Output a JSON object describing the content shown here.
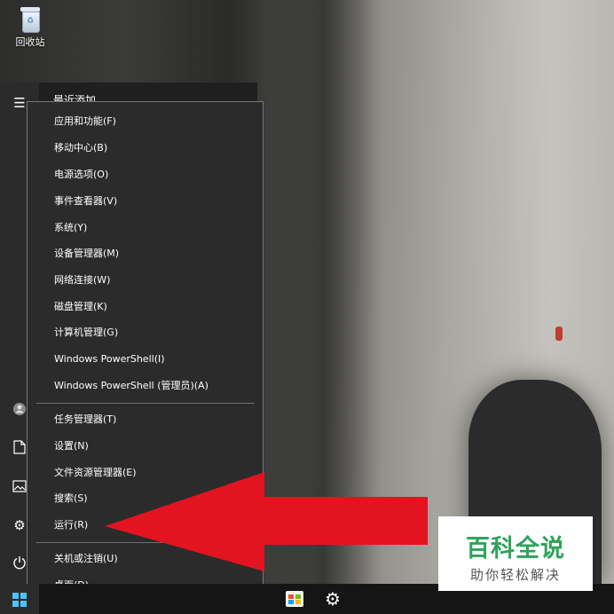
{
  "desktop": {
    "recycle_bin_label": "回收站"
  },
  "start_menu": {
    "recent_label": "最近添加"
  },
  "context_menu": {
    "items": [
      {
        "label": "应用和功能(F)"
      },
      {
        "label": "移动中心(B)"
      },
      {
        "label": "电源选项(O)"
      },
      {
        "label": "事件查看器(V)"
      },
      {
        "label": "系统(Y)"
      },
      {
        "label": "设备管理器(M)"
      },
      {
        "label": "网络连接(W)"
      },
      {
        "label": "磁盘管理(K)"
      },
      {
        "label": "计算机管理(G)"
      },
      {
        "label": "Windows PowerShell(I)"
      },
      {
        "label": "Windows PowerShell (管理员)(A)"
      },
      {
        "label": "任务管理器(T)"
      },
      {
        "label": "设置(N)"
      },
      {
        "label": "文件资源管理器(E)"
      },
      {
        "label": "搜索(S)"
      },
      {
        "label": "运行(R)"
      },
      {
        "label": "关机或注销(U)"
      },
      {
        "label": "桌面(D)"
      }
    ]
  },
  "watermark": {
    "title": "百科全说",
    "subtitle": "助你轻松解决"
  },
  "colors": {
    "menu_bg": "#2b2b2b",
    "arrow": "#e3141f",
    "watermark_green": "#2ea35b",
    "win_accent": "#4cc2ff"
  },
  "icons": {
    "menu": "hamburger-icon",
    "user": "user-icon",
    "documents": "document-icon",
    "pictures": "pictures-icon",
    "settings": "gear-icon",
    "power": "power-icon",
    "start": "windows-logo-icon",
    "store": "store-icon"
  }
}
